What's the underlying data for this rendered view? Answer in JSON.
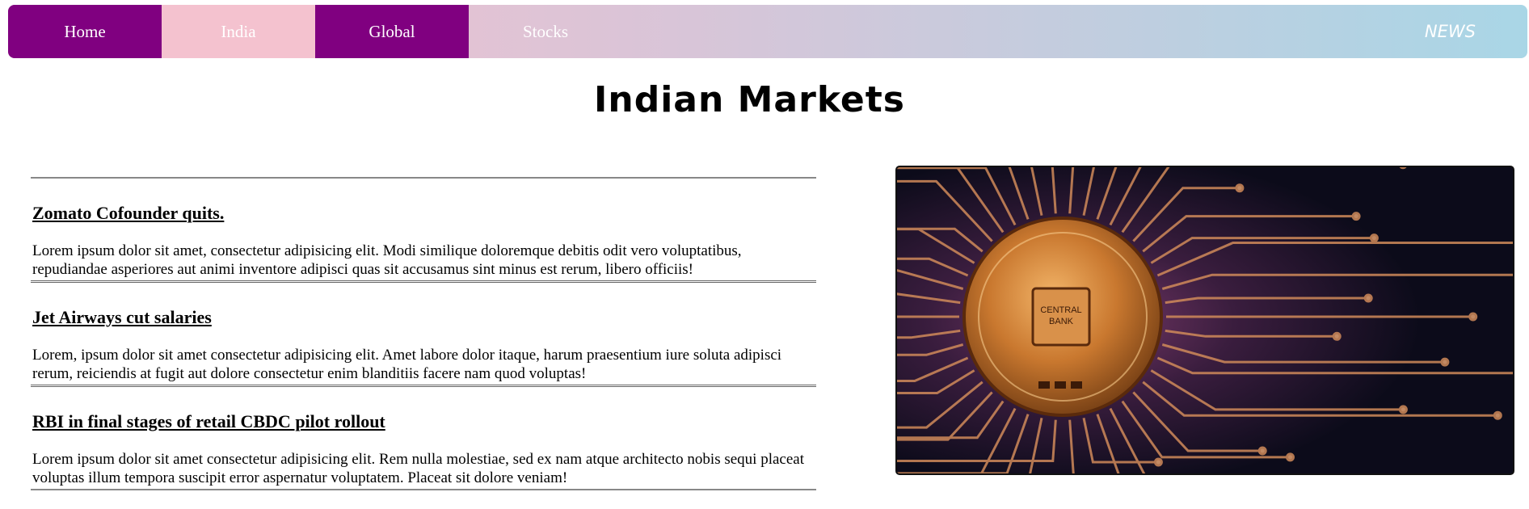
{
  "nav": {
    "items": [
      {
        "label": "Home"
      },
      {
        "label": "India"
      },
      {
        "label": "Global"
      },
      {
        "label": "Stocks"
      }
    ],
    "brand": "NEWS"
  },
  "page": {
    "title": "Indian Markets"
  },
  "articles": [
    {
      "headline": "Zomato Cofounder quits.",
      "body": "Lorem ipsum dolor sit amet, consectetur adipisicing elit. Modi similique doloremque debitis odit vero voluptatibus, repudiandae asperiores aut animi inventore adipisci quas sit accusamus sint minus est rerum, libero officiis!"
    },
    {
      "headline": "Jet Airways cut salaries",
      "body": "Lorem, ipsum dolor sit amet consectetur adipisicing elit. Amet labore dolor itaque, harum praesentium iure soluta adipisci rerum, reiciendis at fugit aut dolore consectetur enim blanditiis facere nam quod voluptas!"
    },
    {
      "headline": "RBI in final stages of retail CBDC pilot rollout",
      "body": "Lorem ipsum dolor sit amet consectetur adipisicing elit. Rem nulla molestiae, sed ex nam atque architecto nobis sequi placeat voluptas illum tempora suscipit error aspernatur voluptatem. Placeat sit dolore veniam!"
    }
  ],
  "hero_image": {
    "chip_label_line1": "CENTRAL",
    "chip_label_line2": "BANK"
  },
  "colors": {
    "nav_active": "#800080",
    "nav_inactive": "#f4c2cf",
    "nav_gradient_end": "#a9d6e6"
  }
}
